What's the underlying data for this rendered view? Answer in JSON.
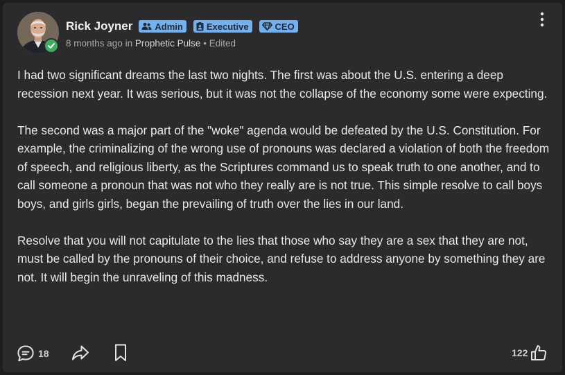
{
  "post": {
    "author": {
      "name": "Rick Joyner",
      "avatar_icon": "author-photo",
      "verified_icon": "check-icon",
      "badges": [
        {
          "label": "Admin",
          "icon": "users-icon"
        },
        {
          "label": "Executive",
          "icon": "id-badge-icon"
        },
        {
          "label": "CEO",
          "icon": "diamond-icon"
        }
      ]
    },
    "meta": {
      "time": "8 months ago",
      "in_label": "in",
      "group": "Prophetic Pulse",
      "separator": "•",
      "edited": "Edited"
    },
    "paragraphs": [
      "I had two significant dreams the last two nights. The first was about the U.S. entering a deep recession next year. It was serious, but it was not the collapse of the economy some were expecting.",
      "The second was a major part of the \"woke\" agenda would be defeated by the U.S. Constitution. For example, the criminalizing of the wrong use of pronouns was declared a violation of both the freedom of speech, and religious liberty, as the Scriptures command us to speak truth to one another, and to call someone a pronoun that was not who they really are is not true. This simple resolve to call boys boys, and girls girls, began the prevailing of truth over the lies in our land.",
      "Resolve that you will not capitulate to the lies that those who say they are a sex that they are not, must be called by the pronouns of their choice, and refuse to address anyone by something they are not. It will begin the unraveling of this madness."
    ],
    "footer": {
      "comments": "18",
      "likes": "122"
    }
  },
  "colors": {
    "background": "#2b2b2d",
    "badge": "#74b0ee",
    "verified": "#3fae63",
    "text": "#e9e9e9"
  }
}
